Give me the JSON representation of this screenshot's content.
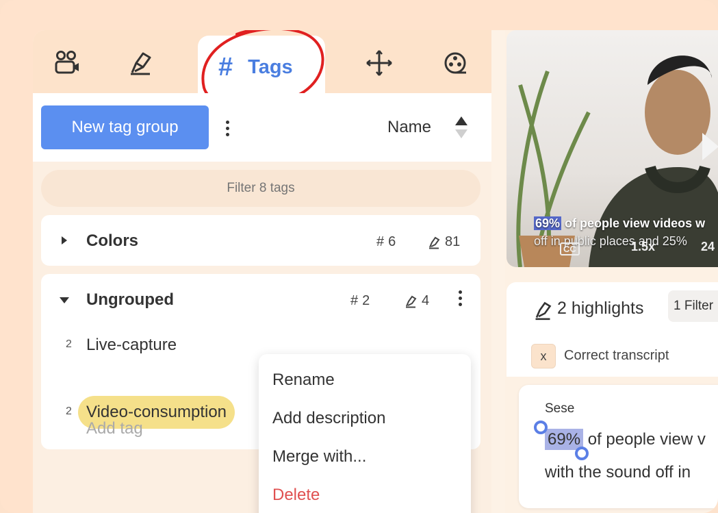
{
  "tabs": {
    "active_label": "Tags",
    "icons": [
      "users-video-icon",
      "highlighter-icon",
      "hash-icon",
      "plus-move-icon",
      "film-reel-icon"
    ]
  },
  "toolbar": {
    "new_group_label": "New tag group",
    "sort_label": "Name"
  },
  "filter": {
    "placeholder": "Filter 8 tags"
  },
  "groups": [
    {
      "name": "Colors",
      "tag_count": "6",
      "highlight_count": "81",
      "expanded": false
    },
    {
      "name": "Ungrouped",
      "tag_count": "2",
      "highlight_count": "4",
      "expanded": true,
      "tags": [
        {
          "count": "2",
          "name": "Live-capture"
        },
        {
          "count": "2",
          "name": "Video-consumption",
          "selected": true
        }
      ],
      "add_tag_label": "Add tag"
    }
  ],
  "context_menu": {
    "rename": "Rename",
    "add_description": "Add description",
    "merge": "Merge with...",
    "delete": "Delete"
  },
  "video": {
    "caption_highlight": "69%",
    "caption_line1_rest": " of people view videos w",
    "caption_line2": "off in public places and 25%",
    "cc_label": "CC",
    "speed": "1.5x",
    "time_partial": "24"
  },
  "highlights": {
    "title": "2 highlights",
    "filter_label": "1 Filter",
    "chip_x": "x",
    "chip_label": "Correct transcript"
  },
  "transcript": {
    "author": "Sese",
    "selected": "69%",
    "line1_rest": " of people view v",
    "line2": "with the sound off in"
  },
  "colors": {
    "accent": "#5b8ff0",
    "annotation": "#e02020",
    "tag_highlight": "#f5e08a",
    "danger": "#e05050"
  }
}
